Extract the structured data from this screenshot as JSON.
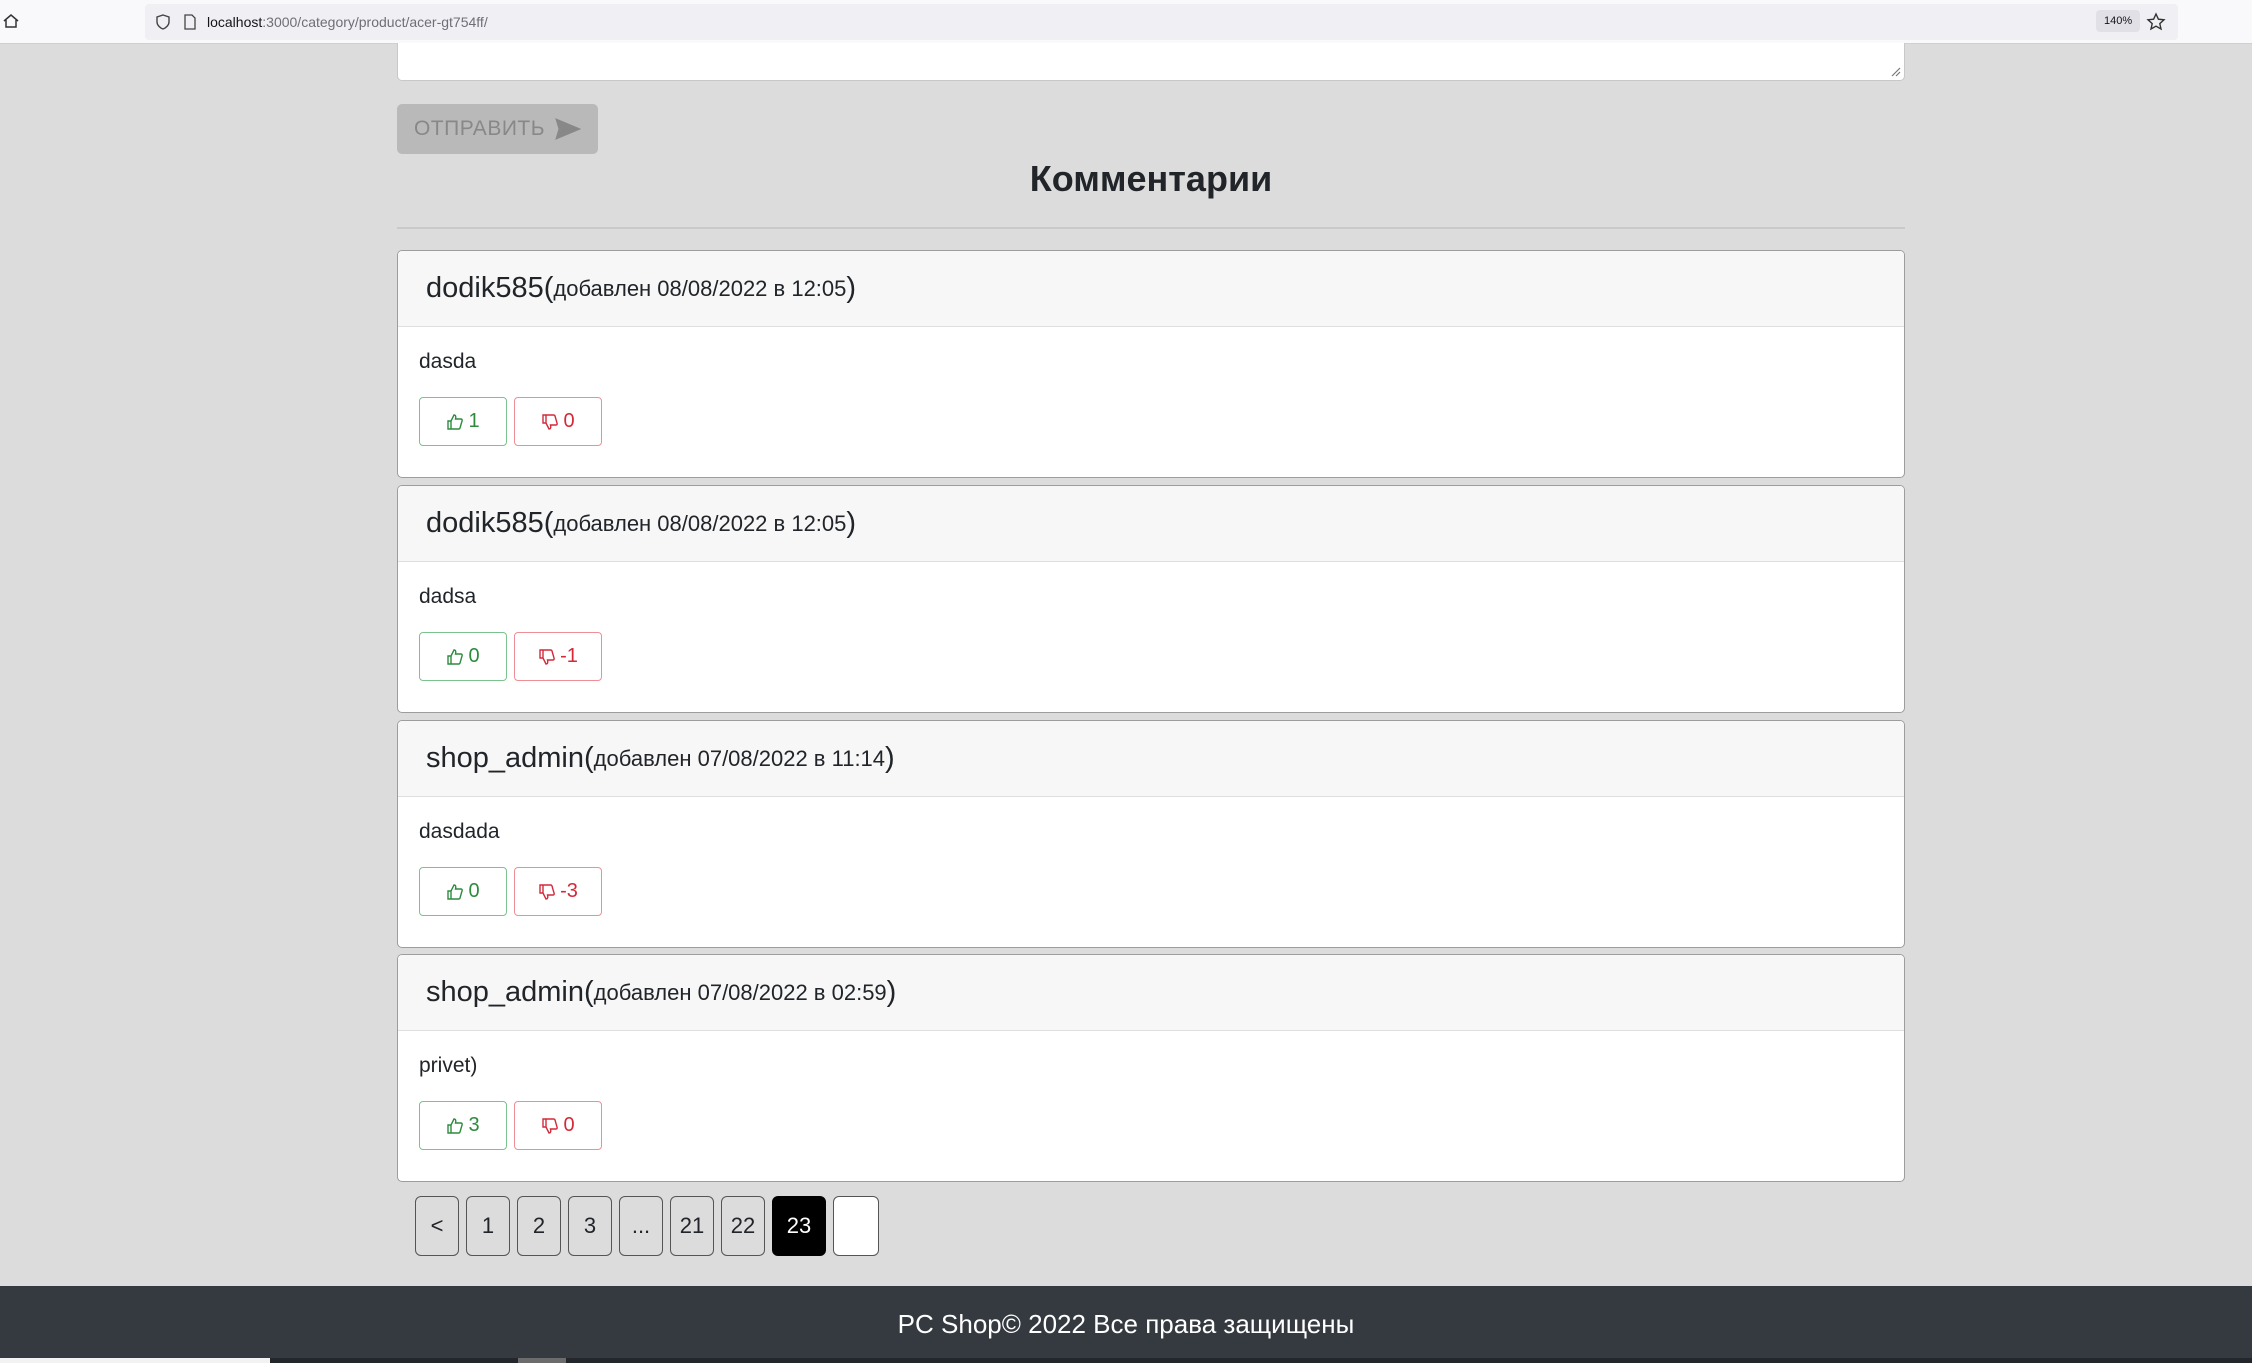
{
  "browser": {
    "url_host": "localhost",
    "url_path": ":3000/category/product/acer-gt754ff/",
    "zoom": "140%"
  },
  "form": {
    "send_label": "ОТПРАВИТЬ"
  },
  "comments": {
    "title": "Комментарии",
    "items": [
      {
        "author": "dodik585",
        "added": "добавлен 08/08/2022 в 12:05",
        "text": "dasda",
        "likes": "1",
        "dislikes": "0"
      },
      {
        "author": "dodik585",
        "added": "добавлен 08/08/2022 в 12:05",
        "text": "dadsa",
        "likes": "0",
        "dislikes": "-1"
      },
      {
        "author": "shop_admin",
        "added": "добавлен 07/08/2022 в 11:14",
        "text": "dasdada",
        "likes": "0",
        "dislikes": "-3"
      },
      {
        "author": "shop_admin",
        "added": "добавлен 07/08/2022 в 02:59",
        "text": "privet)",
        "likes": "3",
        "dislikes": "0"
      }
    ]
  },
  "pagination": {
    "prev": "<",
    "pages": [
      "1",
      "2",
      "3",
      "...",
      "21",
      "22",
      "23",
      ""
    ],
    "active": "23"
  },
  "footer": {
    "text": "PC Shop© 2022 Все права защищены"
  },
  "colors": {
    "page_bg": "#dcdcdc",
    "footer_bg": "#343a40",
    "like": "#2e8b3e",
    "dislike": "#d32a3a"
  }
}
